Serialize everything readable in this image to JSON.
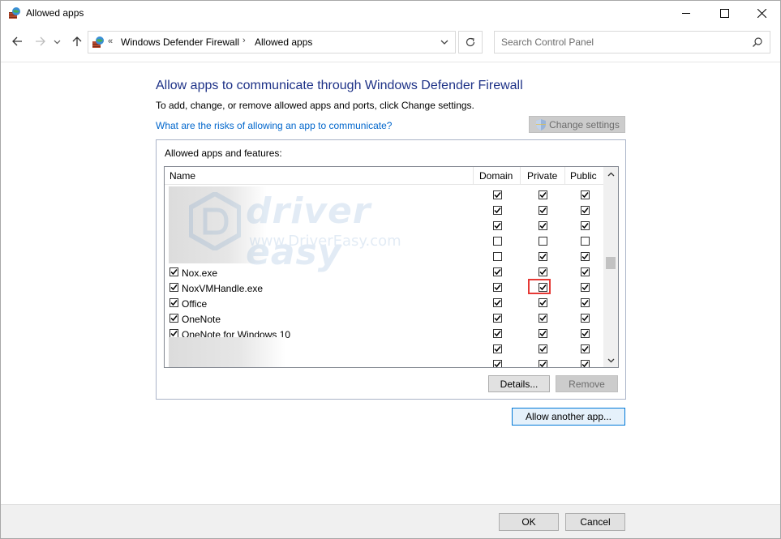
{
  "window": {
    "title": "Allowed apps",
    "icon": "firewall-icon"
  },
  "address": {
    "overflow": "«",
    "crumbs": [
      "Windows Defender Firewall",
      "Allowed apps"
    ],
    "separator": "›"
  },
  "search": {
    "placeholder": "Search Control Panel"
  },
  "content": {
    "title": "Allow apps to communicate through Windows Defender Firewall",
    "instruction": "To add, change, or remove allowed apps and ports, click Change settings.",
    "risk_link": "What are the risks of allowing an app to communicate?",
    "change_settings": "Change settings",
    "group_label": "Allowed apps and features:",
    "columns": {
      "name": "Name",
      "domain": "Domain",
      "private": "Private",
      "public": "Public"
    },
    "rows": [
      {
        "name": "",
        "app": null,
        "domain": true,
        "private": true,
        "public": true
      },
      {
        "name": "",
        "app": null,
        "domain": true,
        "private": true,
        "public": true
      },
      {
        "name": "",
        "app": null,
        "domain": true,
        "private": true,
        "public": true
      },
      {
        "name": "",
        "app": null,
        "domain": false,
        "private": false,
        "public": false
      },
      {
        "name": "",
        "app": null,
        "domain": false,
        "private": true,
        "public": true
      },
      {
        "name": "Nox.exe",
        "app": true,
        "domain": true,
        "private": true,
        "public": true
      },
      {
        "name": "NoxVMHandle.exe",
        "app": true,
        "domain": true,
        "private": true,
        "public": true,
        "highlight": "private"
      },
      {
        "name": "Office",
        "app": true,
        "domain": true,
        "private": true,
        "public": true
      },
      {
        "name": "OneNote",
        "app": true,
        "domain": true,
        "private": true,
        "public": true
      },
      {
        "name": "OneNote for Windows 10",
        "app": true,
        "domain": true,
        "private": true,
        "public": true
      },
      {
        "name": "",
        "app": null,
        "domain": true,
        "private": true,
        "public": true
      },
      {
        "name": "",
        "app": null,
        "domain": true,
        "private": true,
        "public": true
      }
    ],
    "details": "Details...",
    "remove": "Remove",
    "allow_another": "Allow another app..."
  },
  "watermark": {
    "brand": "driver easy",
    "url": "www.DriverEasy.com"
  },
  "footer": {
    "ok": "OK",
    "cancel": "Cancel"
  },
  "colors": {
    "title_blue": "#1e3287",
    "link_blue": "#0066cc",
    "highlight_red": "#e53935",
    "focus_blue": "#0078d7"
  }
}
